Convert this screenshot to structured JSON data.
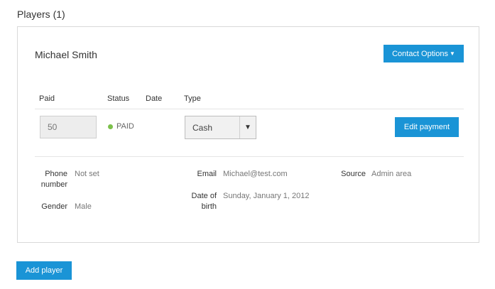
{
  "section": {
    "title": "Players (1)"
  },
  "player": {
    "name": "Michael Smith",
    "contact_options_label": "Contact Options",
    "payment_headers": {
      "paid": "Paid",
      "status": "Status",
      "date": "Date",
      "type": "Type"
    },
    "paid_value": "50",
    "status": "PAID",
    "date": "",
    "type_selected": "Cash",
    "edit_payment_label": "Edit payment",
    "details": {
      "phone_label_1": "Phone",
      "phone_label_2": "number",
      "phone_value": "Not set",
      "email_label": "Email",
      "email_value": "Michael@test.com",
      "source_label": "Source",
      "source_value": "Admin area",
      "dob_label_1": "Date of",
      "dob_label_2": "birth",
      "dob_value": "Sunday, January 1, 2012",
      "gender_label": "Gender",
      "gender_value": "Male"
    }
  },
  "add_player_label": "Add player",
  "colors": {
    "accent": "#1a94d6",
    "paid_dot": "#7cc04b",
    "border": "#d9d9d9"
  },
  "icons": {
    "dropdown": "chevron-down-icon",
    "status": "status-dot-icon"
  }
}
